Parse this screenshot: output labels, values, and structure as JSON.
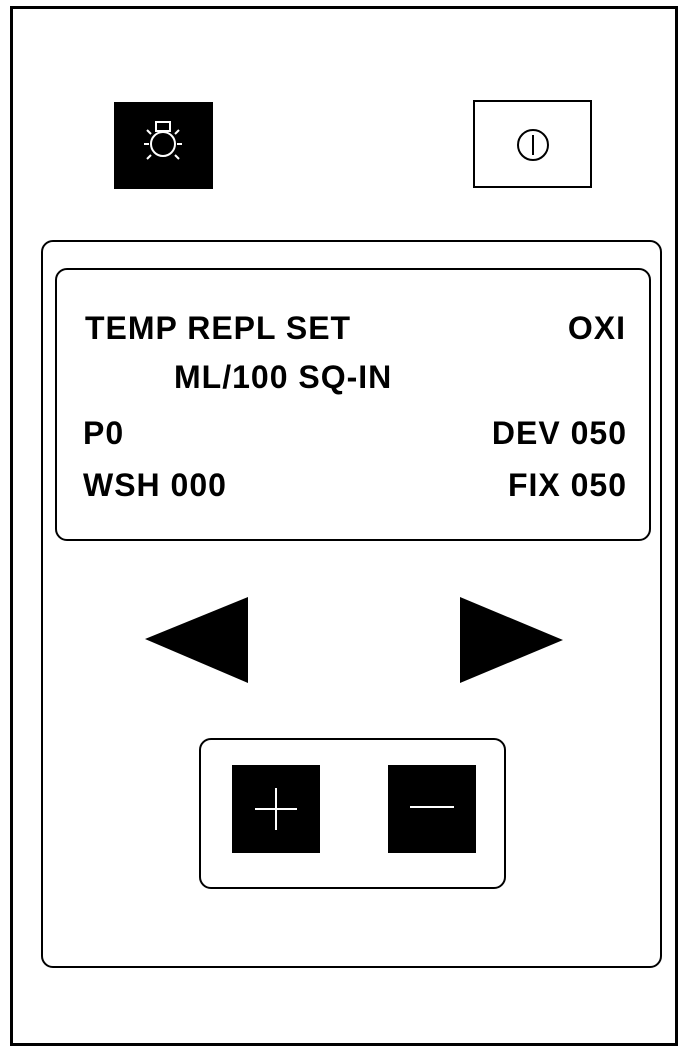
{
  "display": {
    "line1_left": "TEMP REPL SET",
    "line1_right": "OXI",
    "line2": "ML/100 SQ-IN",
    "line3_left": "P0",
    "line3_right": "DEV 050",
    "line4_left": "WSH 000",
    "line4_right": "FIX 050"
  },
  "icons": {
    "light": "light-bulb-icon",
    "power": "power-icon",
    "left": "left-arrow-icon",
    "right": "right-arrow-icon",
    "plus": "plus-icon",
    "minus": "minus-icon"
  },
  "colors": {
    "ink": "#000000",
    "background": "#ffffff"
  }
}
